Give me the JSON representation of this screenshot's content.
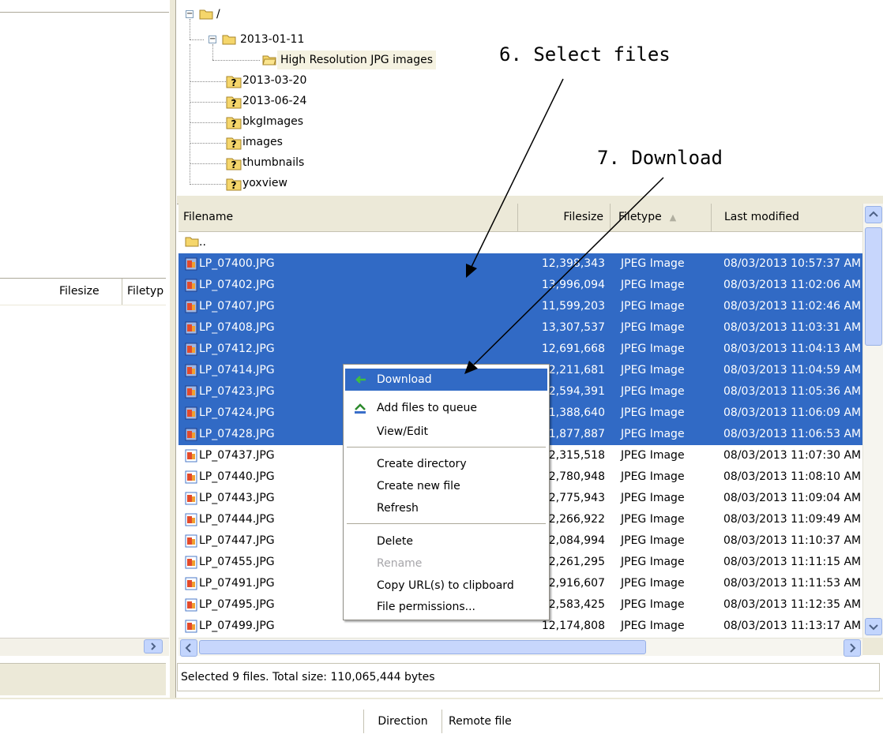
{
  "left_pane": {
    "columns": [
      "Filesize",
      "Filetyp"
    ]
  },
  "tree": {
    "root": "/",
    "items": [
      {
        "label": "2013-01-11",
        "expanded": true
      },
      {
        "label": "High Resolution JPG images",
        "selected": true
      },
      {
        "label": "2013-03-20"
      },
      {
        "label": "2013-06-24"
      },
      {
        "label": "bkgImages"
      },
      {
        "label": "images"
      },
      {
        "label": "thumbnails"
      },
      {
        "label": "yoxview"
      }
    ]
  },
  "list": {
    "headers": {
      "filename": "Filename",
      "filesize": "Filesize",
      "filetype": "Filetype",
      "modified": "Last modified"
    },
    "sort_indicator": "▲",
    "parent": "..",
    "rows": [
      {
        "name": "LP_07400.JPG",
        "size": "12,398,343",
        "type": "JPEG Image",
        "modified": "08/03/2013 10:57:37 AM",
        "selected": true
      },
      {
        "name": "LP_07402.JPG",
        "size": "13,996,094",
        "type": "JPEG Image",
        "modified": "08/03/2013 11:02:06 AM",
        "selected": true
      },
      {
        "name": "LP_07407.JPG",
        "size": "11,599,203",
        "type": "JPEG Image",
        "modified": "08/03/2013 11:02:46 AM",
        "selected": true
      },
      {
        "name": "LP_07408.JPG",
        "size": "13,307,537",
        "type": "JPEG Image",
        "modified": "08/03/2013 11:03:31 AM",
        "selected": true
      },
      {
        "name": "LP_07412.JPG",
        "size": "12,691,668",
        "type": "JPEG Image",
        "modified": "08/03/2013 11:04:13 AM",
        "selected": true
      },
      {
        "name": "LP_07414.JPG",
        "size": "12,211,681",
        "type": "JPEG Image",
        "modified": "08/03/2013 11:04:59 AM",
        "selected": true
      },
      {
        "name": "LP_07423.JPG",
        "size": "12,594,391",
        "type": "JPEG Image",
        "modified": "08/03/2013 11:05:36 AM",
        "selected": true
      },
      {
        "name": "LP_07424.JPG",
        "size": "11,388,640",
        "type": "JPEG Image",
        "modified": "08/03/2013 11:06:09 AM",
        "selected": true
      },
      {
        "name": "LP_07428.JPG",
        "size": "11,877,887",
        "type": "JPEG Image",
        "modified": "08/03/2013 11:06:53 AM",
        "selected": true
      },
      {
        "name": "LP_07437.JPG",
        "size": "12,315,518",
        "type": "JPEG Image",
        "modified": "08/03/2013 11:07:30 AM",
        "selected": false
      },
      {
        "name": "LP_07440.JPG",
        "size": "12,780,948",
        "type": "JPEG Image",
        "modified": "08/03/2013 11:08:10 AM",
        "selected": false
      },
      {
        "name": "LP_07443.JPG",
        "size": "12,775,943",
        "type": "JPEG Image",
        "modified": "08/03/2013 11:09:04 AM",
        "selected": false
      },
      {
        "name": "LP_07444.JPG",
        "size": "12,266,922",
        "type": "JPEG Image",
        "modified": "08/03/2013 11:09:49 AM",
        "selected": false
      },
      {
        "name": "LP_07447.JPG",
        "size": "12,084,994",
        "type": "JPEG Image",
        "modified": "08/03/2013 11:10:37 AM",
        "selected": false
      },
      {
        "name": "LP_07455.JPG",
        "size": "12,261,295",
        "type": "JPEG Image",
        "modified": "08/03/2013 11:11:15 AM",
        "selected": false
      },
      {
        "name": "LP_07491.JPG",
        "size": "12,916,607",
        "type": "JPEG Image",
        "modified": "08/03/2013 11:11:53 AM",
        "selected": false
      },
      {
        "name": "LP_07495.JPG",
        "size": "12,583,425",
        "type": "JPEG Image",
        "modified": "08/03/2013 11:12:35 AM",
        "selected": false
      },
      {
        "name": "LP_07499.JPG",
        "size": "12,174,808",
        "type": "JPEG Image",
        "modified": "08/03/2013 11:13:17 AM",
        "selected": false
      }
    ]
  },
  "context_menu": {
    "items": [
      {
        "label": "Download",
        "icon": "download-arrow-icon",
        "highlighted": true
      },
      {
        "label": "Add files to queue",
        "icon": "add-to-queue-icon"
      },
      {
        "label": "View/Edit"
      },
      {
        "separator": true
      },
      {
        "label": "Create directory"
      },
      {
        "label": "Create new file"
      },
      {
        "label": "Refresh"
      },
      {
        "separator": true
      },
      {
        "label": "Delete"
      },
      {
        "label": "Rename",
        "disabled": true
      },
      {
        "label": "Copy URL(s) to clipboard"
      },
      {
        "label": "File permissions..."
      }
    ]
  },
  "status": "Selected 9 files. Total size: 110,065,444 bytes",
  "queue": {
    "columns": [
      "Direction",
      "Remote file"
    ]
  },
  "annotations": {
    "select": "6. Select files",
    "download": "7. Download"
  },
  "colors": {
    "selection": "#316ac5",
    "chrome": "#ece9d8",
    "folder": "#f5d66b"
  }
}
